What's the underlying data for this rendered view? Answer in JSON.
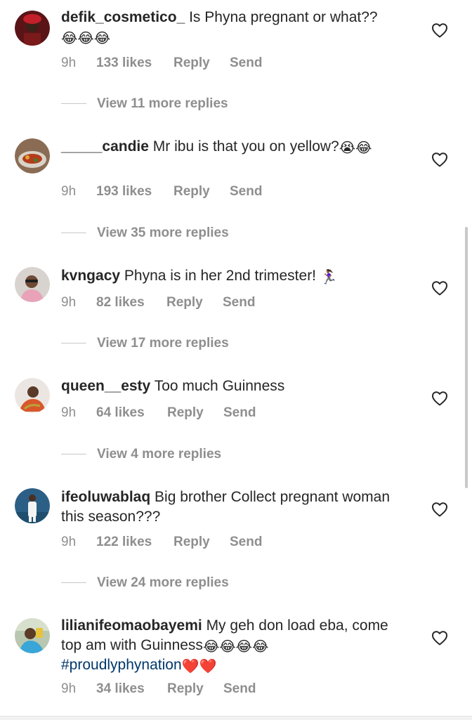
{
  "comments": [
    {
      "username": "defik_cosmetico_",
      "text": " Is Phyna pregnant or what?? ",
      "emojis": "😂😂😂",
      "time": "9h",
      "likes": "133 likes",
      "reply": "Reply",
      "send": "Send",
      "view_replies": "View 11 more replies"
    },
    {
      "username": "_____candie",
      "text": " Mr ibu is that you on yellow?",
      "emojis": "😭😂",
      "time": "9h",
      "likes": "193 likes",
      "reply": "Reply",
      "send": "Send",
      "view_replies": "View 35 more replies"
    },
    {
      "username": "kvngacy",
      "text": " Phyna is in her 2nd trimester! ",
      "emojis": "🏃🏾‍♀️",
      "time": "9h",
      "likes": "82 likes",
      "reply": "Reply",
      "send": "Send",
      "view_replies": "View 17 more replies"
    },
    {
      "username": "queen__esty",
      "text": " Too much Guinness",
      "time": "9h",
      "likes": "64 likes",
      "reply": "Reply",
      "send": "Send",
      "view_replies": "View 4 more replies"
    },
    {
      "username": "ifeoluwablaq",
      "text": " Big brother Collect pregnant woman this season???",
      "time": "9h",
      "likes": "122 likes",
      "reply": "Reply",
      "send": "Send",
      "view_replies": "View 24 more replies"
    },
    {
      "username": "lilianifeomaobayemi",
      "text": " My geh don load eba, come top am with Guinness",
      "emojis": "😂😂😂😂",
      "hashtag": "#proudlyphynation",
      "hashtag_emojis": "❤️❤️",
      "time": "9h",
      "likes": "34 likes",
      "reply": "Reply",
      "send": "Send"
    }
  ],
  "icons": {
    "like": "heart-outline-icon"
  },
  "colors": {
    "text": "#262626",
    "secondary": "#8e8e8e",
    "hashtag": "#00376b"
  }
}
